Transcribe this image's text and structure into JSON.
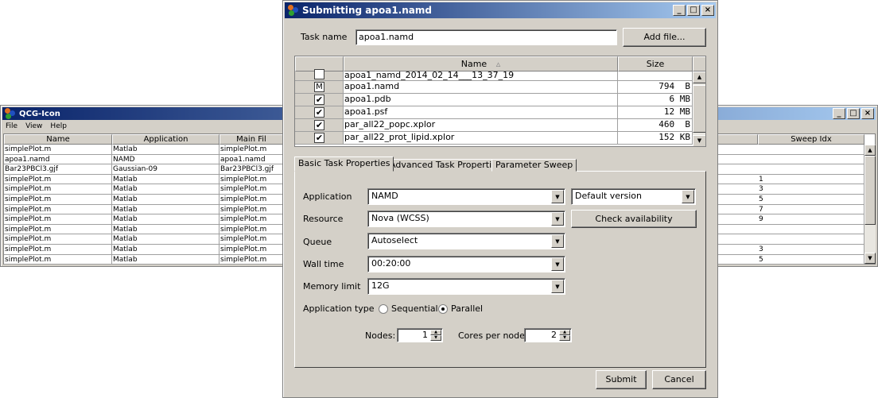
{
  "bg_window": {
    "title": "QCG-Icon",
    "menu": [
      "File",
      "View",
      "Help"
    ],
    "columns": [
      "Name",
      "Application",
      "Main Fil",
      "Sweep Idx"
    ],
    "rows": [
      {
        "name": "simplePlot.m",
        "app": "Matlab",
        "main": "simplePlot.m",
        "sweep": ""
      },
      {
        "name": "apoa1.namd",
        "app": "NAMD",
        "main": "apoa1.namd",
        "sweep": ""
      },
      {
        "name": "Bar23PBCl3.gjf",
        "app": "Gaussian-09",
        "main": "Bar23PBCl3.gjf",
        "sweep": ""
      },
      {
        "name": "simplePlot.m",
        "app": "Matlab",
        "main": "simplePlot.m",
        "sweep": "1"
      },
      {
        "name": "simplePlot.m",
        "app": "Matlab",
        "main": "simplePlot.m",
        "sweep": "3"
      },
      {
        "name": "simplePlot.m",
        "app": "Matlab",
        "main": "simplePlot.m",
        "sweep": "5"
      },
      {
        "name": "simplePlot.m",
        "app": "Matlab",
        "main": "simplePlot.m",
        "sweep": "7"
      },
      {
        "name": "simplePlot.m",
        "app": "Matlab",
        "main": "simplePlot.m",
        "sweep": "9"
      },
      {
        "name": "simplePlot.m",
        "app": "Matlab",
        "main": "simplePlot.m",
        "sweep": ""
      },
      {
        "name": "simplePlot.m",
        "app": "Matlab",
        "main": "simplePlot.m",
        "sweep": ""
      },
      {
        "name": "simplePlot.m",
        "app": "Matlab",
        "main": "simplePlot.m",
        "sweep": "3"
      },
      {
        "name": "simplePlot.m",
        "app": "Matlab",
        "main": "simplePlot.m",
        "sweep": "5"
      }
    ]
  },
  "dialog": {
    "title": "Submitting apoa1.namd",
    "task_name_label": "Task name",
    "task_name_value": "apoa1.namd",
    "add_file": "Add file...",
    "file_columns": {
      "name": "Name",
      "size": "Size",
      "sort_icon": "▵"
    },
    "files": [
      {
        "check": "",
        "name": "apoa1_namd_2014_02_14___13_37_19",
        "size": ""
      },
      {
        "check": "M",
        "name": "apoa1.namd",
        "size": "794  B"
      },
      {
        "check": "✔",
        "name": "apoa1.pdb",
        "size": "6 MB"
      },
      {
        "check": "✔",
        "name": "apoa1.psf",
        "size": "12 MB"
      },
      {
        "check": "✔",
        "name": "par_all22_popc.xplor",
        "size": "460  B"
      },
      {
        "check": "✔",
        "name": "par_all22_prot_lipid.xplor",
        "size": "152 KB"
      }
    ],
    "tabs": [
      "Basic Task Properties",
      "Advanced Task Properties",
      "Parameter Sweep"
    ],
    "form": {
      "application_label": "Application",
      "application": "NAMD",
      "version": "Default version",
      "resource_label": "Resource",
      "resource": "Nova (WCSS)",
      "check_availability": "Check availability",
      "queue_label": "Queue",
      "queue": "Autoselect",
      "walltime_label": "Wall time",
      "walltime": "00:20:00",
      "memory_label": "Memory limit",
      "memory": "12G",
      "apptype_label": "Application type",
      "sequential": "Sequential",
      "parallel": "Parallel",
      "apptype_selected": "Parallel",
      "nodes_label": "Nodes:",
      "nodes": "1",
      "cores_label": "Cores per node:",
      "cores": "2"
    },
    "submit": "Submit",
    "cancel": "Cancel"
  }
}
